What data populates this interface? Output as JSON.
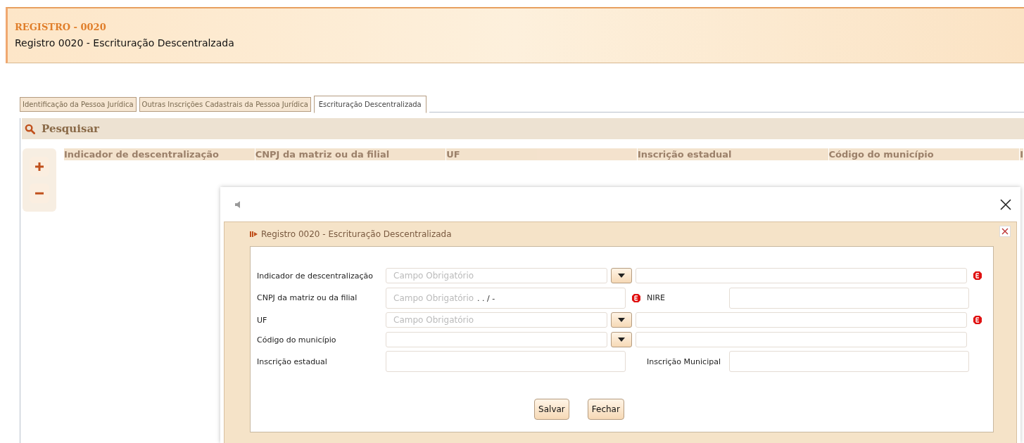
{
  "header": {
    "code": "REGISTRO - 0020",
    "title": "Registro 0020 - Escrituração Descentralzada"
  },
  "tabs": [
    {
      "label": "Identificação da Pessoa Jurídica",
      "selected": false
    },
    {
      "label": "Outras Inscrições Cadastrais da Pessoa Jurídica",
      "selected": false
    },
    {
      "label": "Escrituração Descentralizada",
      "selected": true
    }
  ],
  "search": {
    "title": "Pesquisar"
  },
  "table": {
    "columns": [
      "Indicador de descentralização",
      "CNPJ da matriz ou da filial",
      "UF",
      "Inscrição estadual",
      "Código do município",
      "I"
    ]
  },
  "dialog": {
    "title": "Registro 0020 - Escrituração Descentralizada",
    "fields": [
      {
        "kind": "combo",
        "label": "Indicador de descentralização",
        "placeholder": "Campo Obrigatório",
        "required": true
      },
      {
        "kind": "split",
        "label": "CNPJ da matriz ou da filial",
        "placeholder": "Campo Obrigatório",
        "mask": ". . / -",
        "required": true,
        "label2": "NIRE"
      },
      {
        "kind": "combo",
        "label": "UF",
        "placeholder": "Campo Obrigatório",
        "required": true
      },
      {
        "kind": "combo",
        "label": "Código do município",
        "required": false
      },
      {
        "kind": "split",
        "label": "Inscrição estadual",
        "required": false,
        "label2": "Inscrição Municipal"
      }
    ],
    "buttons": [
      "Salvar",
      "Fechar"
    ]
  }
}
